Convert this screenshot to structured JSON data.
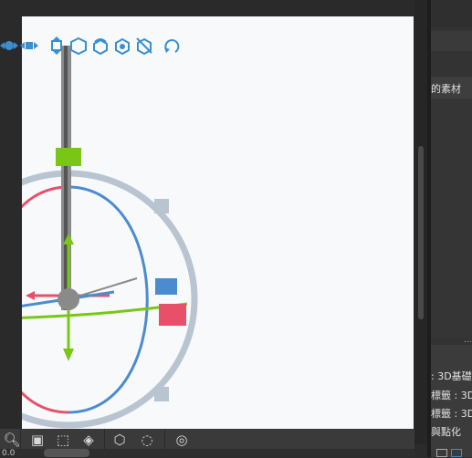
{
  "window": {
    "title": ""
  },
  "toolbar_3d": {
    "items": [
      {
        "label": "",
        "icon": "move-pan-icon"
      },
      {
        "label": "",
        "icon": "move-arrows-icon"
      },
      {
        "label": "",
        "icon": "rotate-cube-icon"
      },
      {
        "label": "",
        "icon": "move-object-icon"
      },
      {
        "label": "",
        "icon": "rotate-object-icon"
      },
      {
        "label": "",
        "icon": "scale-object-icon"
      },
      {
        "label": "",
        "icon": "fit-view-icon"
      },
      {
        "label": "",
        "icon": "reset-rotation-icon"
      }
    ]
  },
  "gizmo": {
    "axis_colors": {
      "x": "#e8506a",
      "y": "#7ac617",
      "z": "#4b8bd0",
      "ring_outer": "#b8c4d0"
    }
  },
  "right_panel": {
    "materials_tab": "的素材",
    "list_items": [
      ": 3D基礎",
      "標籤 : 3D",
      "標籤 : 3D",
      "與點化"
    ],
    "more_indicator": "..."
  },
  "bottom_bar": {
    "tools": [
      {
        "icon": "zoom-icon"
      },
      {
        "icon": "camera-icon"
      },
      {
        "icon": "frame-select-icon"
      },
      {
        "icon": "object-list-icon"
      },
      {
        "icon": "materials-icon"
      },
      {
        "icon": "pose-icon"
      },
      {
        "icon": "globe-grid-icon"
      }
    ],
    "zoom_value": "0.0"
  },
  "colors": {
    "canvas_bg": "#f8f9fa",
    "panel_bg": "#333333",
    "toolbar_icon": "#3a8fd0"
  }
}
